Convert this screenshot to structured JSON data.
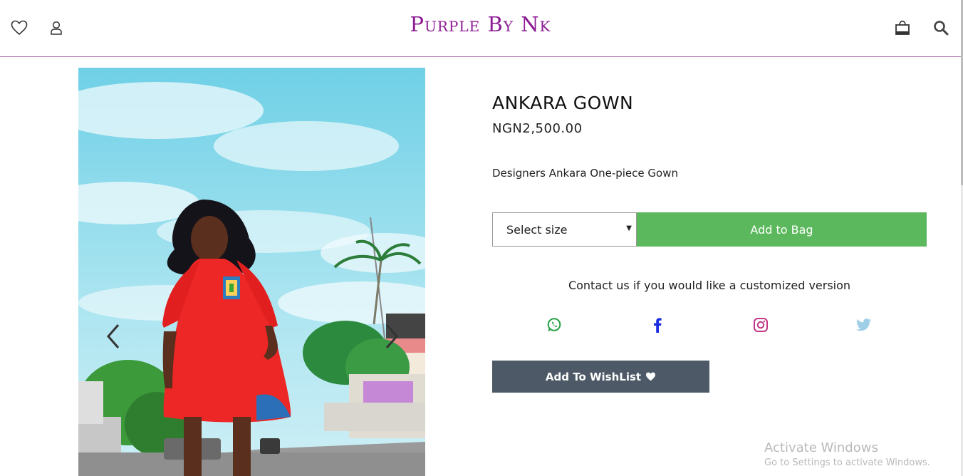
{
  "header": {
    "brand": "Purple By Nk",
    "icons": [
      "heart-icon",
      "user-icon",
      "shopping-bag-icon",
      "search-icon"
    ]
  },
  "product": {
    "name": "ANKARA GOWN",
    "price": "NGN2,500.00",
    "description": "Designers Ankara One-piece Gown",
    "size_select": {
      "selected": "Select size"
    },
    "add_to_bag": "Add to Bag",
    "contact_text": "Contact us if you would like a customized version",
    "social_icons": [
      "whatsapp-icon",
      "facebook-icon",
      "instagram-icon",
      "twitter-icon"
    ],
    "wishlist_button": "Add To WishList",
    "wishlist_icon": "heart-icon"
  },
  "watermark": {
    "line1": "Activate Windows",
    "line2": "Go to Settings to activate Windows."
  },
  "colors": {
    "brand": "#8b1a93",
    "add_to_bag": "#5cb85c",
    "wishlist": "#4d5966",
    "whatsapp": "#25a244",
    "facebook": "#1b2ee0",
    "instagram": "#c13584",
    "twitter": "#9ecfe6"
  }
}
